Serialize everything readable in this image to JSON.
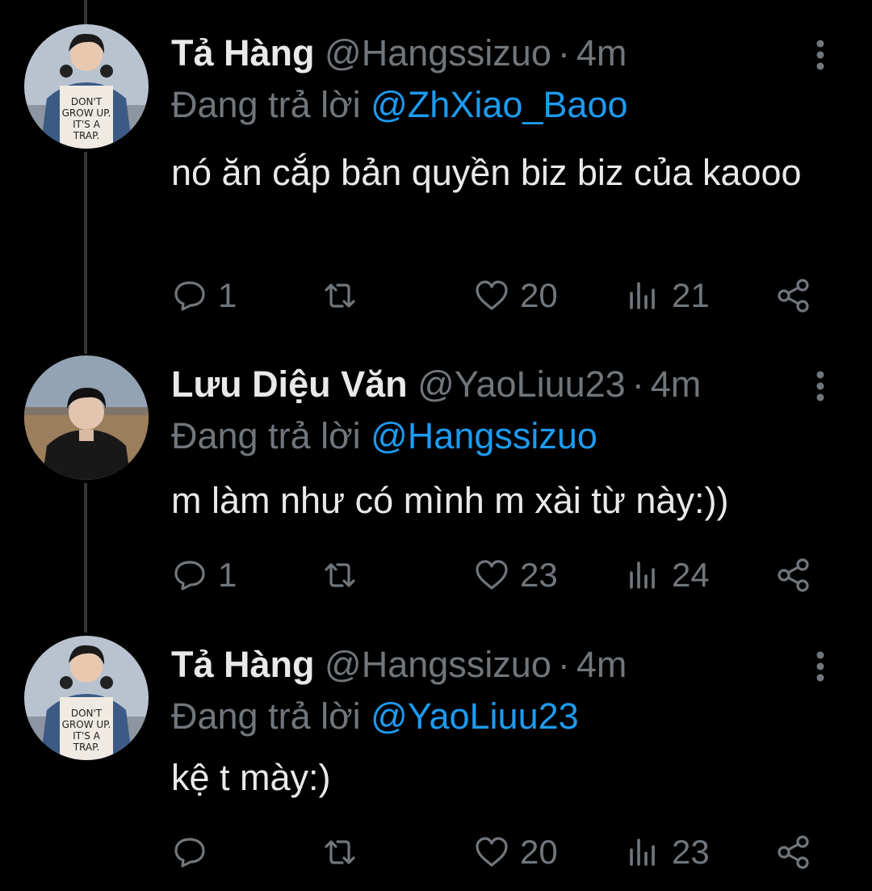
{
  "tweets": [
    {
      "name": "Tả Hàng",
      "handle": "@Hangssizuo",
      "dot": "·",
      "time": "4m",
      "reply_prefix": "Đang trả lời",
      "reply_mention": "@ZhXiao_Baoo",
      "text": "nó ăn cắp bản quyền biz biz của kaooo",
      "replies": "1",
      "retweets": "",
      "likes": "20",
      "views": "21",
      "avatar": "avatar-hangssizuo",
      "avatar_print": "DON'T GROW UP. IT'S A TRAP."
    },
    {
      "name": "Lưu Diệu Văn",
      "handle": "@YaoLiuu23",
      "dot": "·",
      "time": "4m",
      "reply_prefix": "Đang trả lời",
      "reply_mention": "@Hangssizuo",
      "text": "m làm như có mình m xài từ này:))",
      "replies": "1",
      "retweets": "",
      "likes": "23",
      "views": "24",
      "avatar": "avatar-yaoliuu23"
    },
    {
      "name": "Tả Hàng",
      "handle": "@Hangssizuo",
      "dot": "·",
      "time": "4m",
      "reply_prefix": "Đang trả lời",
      "reply_mention": "@YaoLiuu23",
      "text": "kệ t mày:)",
      "replies": "",
      "retweets": "",
      "likes": "20",
      "views": "23",
      "avatar": "avatar-hangssizuo",
      "avatar_print": "DON'T GROW UP. IT'S A TRAP."
    }
  ],
  "icons": {
    "reply": "reply-icon",
    "retweet": "retweet-icon",
    "like": "heart-icon",
    "views": "views-icon",
    "share": "share-icon",
    "more": "more-vertical-icon"
  },
  "colors": {
    "background": "#000000",
    "primary_text": "#e7e9ea",
    "secondary_text": "#71767b",
    "link": "#1d9bf0",
    "thread_line": "#333639"
  }
}
